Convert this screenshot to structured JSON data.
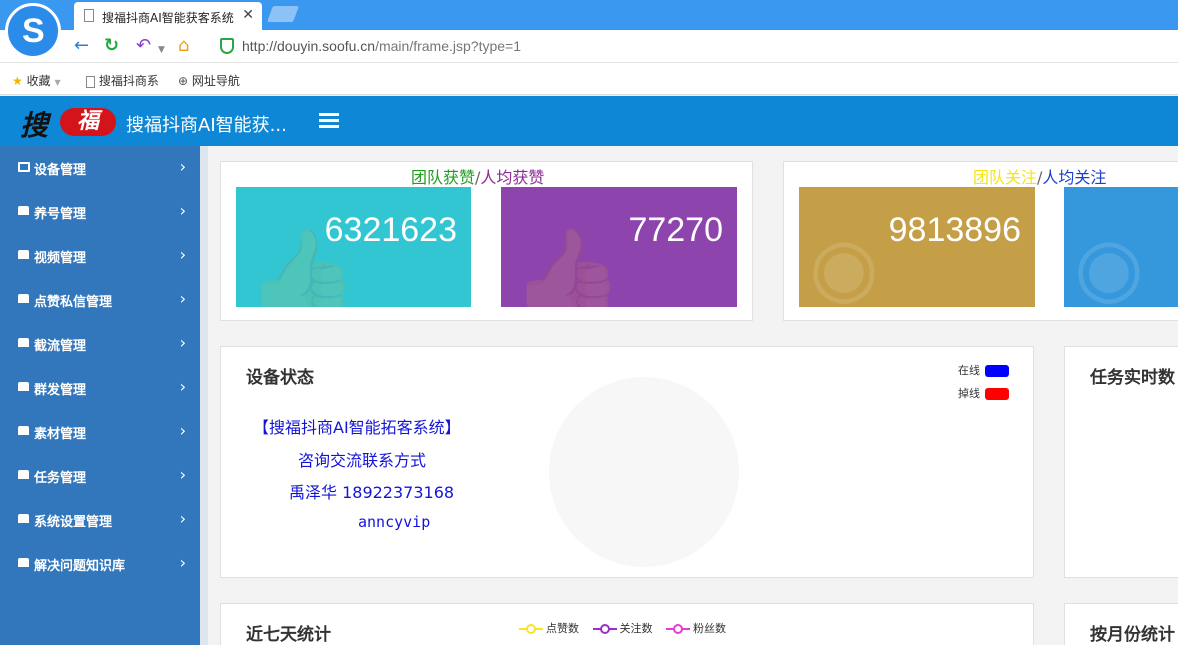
{
  "browser": {
    "tab_title": "搜福抖商AI智能获客系统",
    "url_host": "http://douyin.soofu.cn",
    "url_path": "/main/frame.jsp?type=1",
    "bookmarks": [
      "收藏",
      "搜福抖商系",
      "网址导航"
    ]
  },
  "app": {
    "logo_text_a": "搜",
    "logo_text_b": "福",
    "title": "搜福抖商AI智能获..."
  },
  "sidebar": {
    "items": [
      {
        "label": "设备管理"
      },
      {
        "label": "养号管理"
      },
      {
        "label": "视频管理"
      },
      {
        "label": "点赞私信管理"
      },
      {
        "label": "截流管理"
      },
      {
        "label": "群发管理"
      },
      {
        "label": "素材管理"
      },
      {
        "label": "任务管理"
      },
      {
        "label": "系统设置管理"
      },
      {
        "label": "解决问题知识库"
      }
    ]
  },
  "stats": {
    "likes": {
      "title_team": "团队获赞",
      "sep": "/",
      "title_avg": "人均获赞",
      "team_value": "6321623",
      "avg_value": "77270",
      "team_color": "#32c5d2",
      "avg_color": "#8e44ad"
    },
    "follows": {
      "title_team": "团队关注",
      "sep": "/",
      "title_avg": "人均关注",
      "team_value": "9813896",
      "team_color": "#c49f47",
      "avg_color": "#3598dc"
    }
  },
  "device_status": {
    "title": "设备状态",
    "legend": [
      {
        "label": "在线",
        "color": "#0000ff"
      },
      {
        "label": "掉线",
        "color": "#ff0000"
      }
    ],
    "promo": {
      "line1": "【搜福抖商AI智能拓客系统】",
      "line2": "咨询交流联系方式",
      "line3": "禹泽华 18922373168",
      "line4": "anncyvip"
    }
  },
  "task_realtime": {
    "title": "任务实时数"
  },
  "seven_days": {
    "title": "近七天统计",
    "legend": [
      {
        "label": "点赞数",
        "color": "#f6e32a"
      },
      {
        "label": "关注数",
        "color": "#9b2fc9"
      },
      {
        "label": "粉丝数",
        "color": "#e83ad6"
      }
    ]
  },
  "monthly": {
    "title": "按月份统计"
  }
}
